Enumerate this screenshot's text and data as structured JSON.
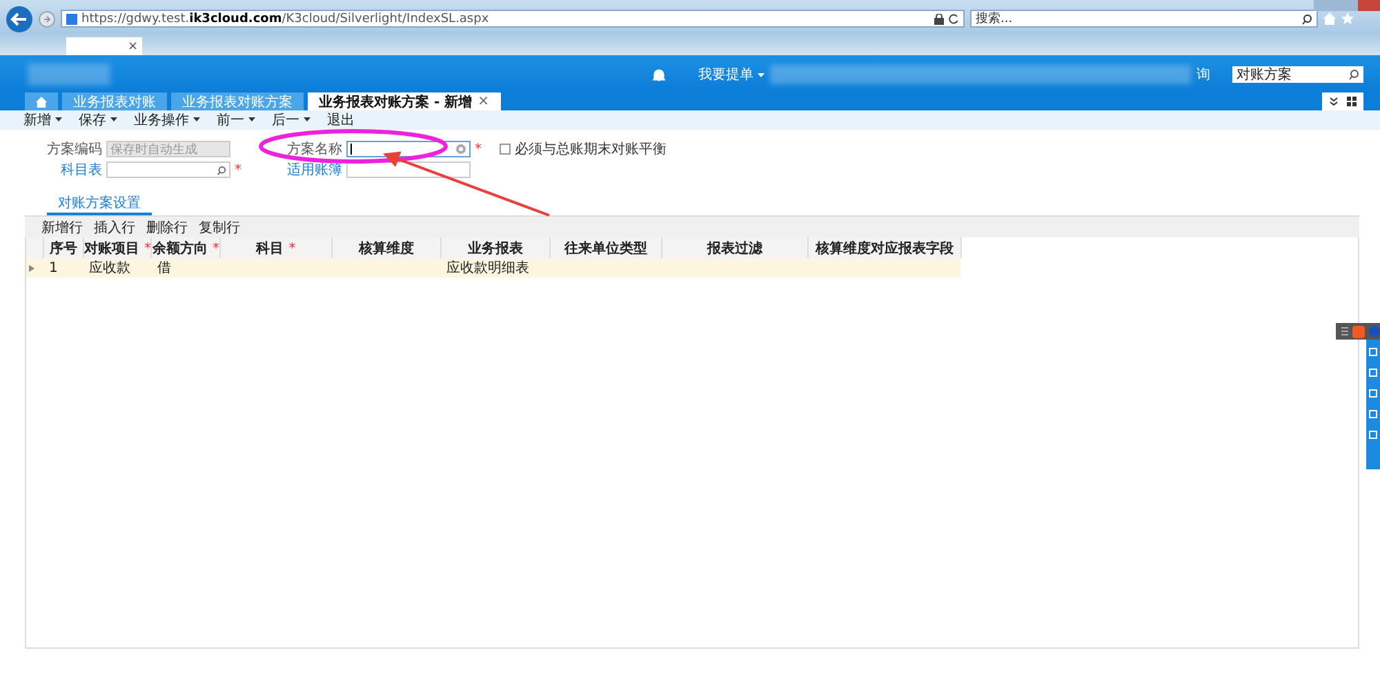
{
  "browser": {
    "url_host": "https://gdwy.test.",
    "url_domain": "ik3cloud.com",
    "url_path": "/K3cloud/Silverlight/IndexSL.aspx",
    "search_placeholder": "搜索...",
    "tab_close": "×"
  },
  "header": {
    "menu_label": "我要提单",
    "menu_tail": "询",
    "search_value": "对账方案"
  },
  "tabs": [
    {
      "kind": "home",
      "selected": false
    },
    {
      "kind": "text",
      "label": "业务报表对账",
      "selected": false
    },
    {
      "kind": "text",
      "label": "业务报表对账方案",
      "selected": false
    },
    {
      "kind": "text",
      "label": "业务报表对账方案 - 新增",
      "selected": true,
      "close": "×"
    }
  ],
  "toolbar": [
    {
      "label": "新增",
      "dropdown": true
    },
    {
      "label": "保存",
      "dropdown": true
    },
    {
      "label": "业务操作",
      "dropdown": true
    },
    {
      "label": "前一",
      "dropdown": true
    },
    {
      "label": "后一",
      "dropdown": true
    },
    {
      "label": "退出",
      "dropdown": false
    }
  ],
  "form": {
    "columns": [
      [
        {
          "label": "方案编码",
          "link": false,
          "placeholder": "保存时自动生成",
          "disabled": true,
          "kind": "plain"
        },
        {
          "label": "科目表",
          "link": true,
          "disabled": false,
          "required_mark": "*",
          "kind": "search"
        }
      ],
      [
        {
          "label": "方案名称",
          "link": false,
          "disabled": false,
          "required_mark": "*",
          "kind": "lookup",
          "focused": true
        },
        {
          "label": "适用账簿",
          "link": true,
          "disabled": false,
          "kind": "plain"
        }
      ]
    ],
    "checkbox": {
      "label": "必须与总账期末对账平衡",
      "checked": false
    }
  },
  "panel": {
    "tabs": [
      {
        "label": "对账方案设置",
        "selected": true
      }
    ],
    "grid_toolbar": [
      "新增行",
      "插入行",
      "删除行",
      "复制行"
    ],
    "columns": [
      {
        "label": "序号"
      },
      {
        "label": "对账项目",
        "required_mark": "*"
      },
      {
        "label": "余额方向",
        "required_mark": "*"
      },
      {
        "label": "科目",
        "required_mark": "*"
      },
      {
        "label": "核算维度"
      },
      {
        "label": "业务报表"
      },
      {
        "label": "往来单位类型"
      },
      {
        "label": "报表过滤"
      },
      {
        "label": "核算维度对应报表字段"
      }
    ],
    "rows": [
      {
        "selected": true,
        "cells": [
          "1",
          "应收款",
          "借",
          null,
          null,
          "应收款明细表",
          null,
          null,
          null
        ]
      }
    ]
  }
}
